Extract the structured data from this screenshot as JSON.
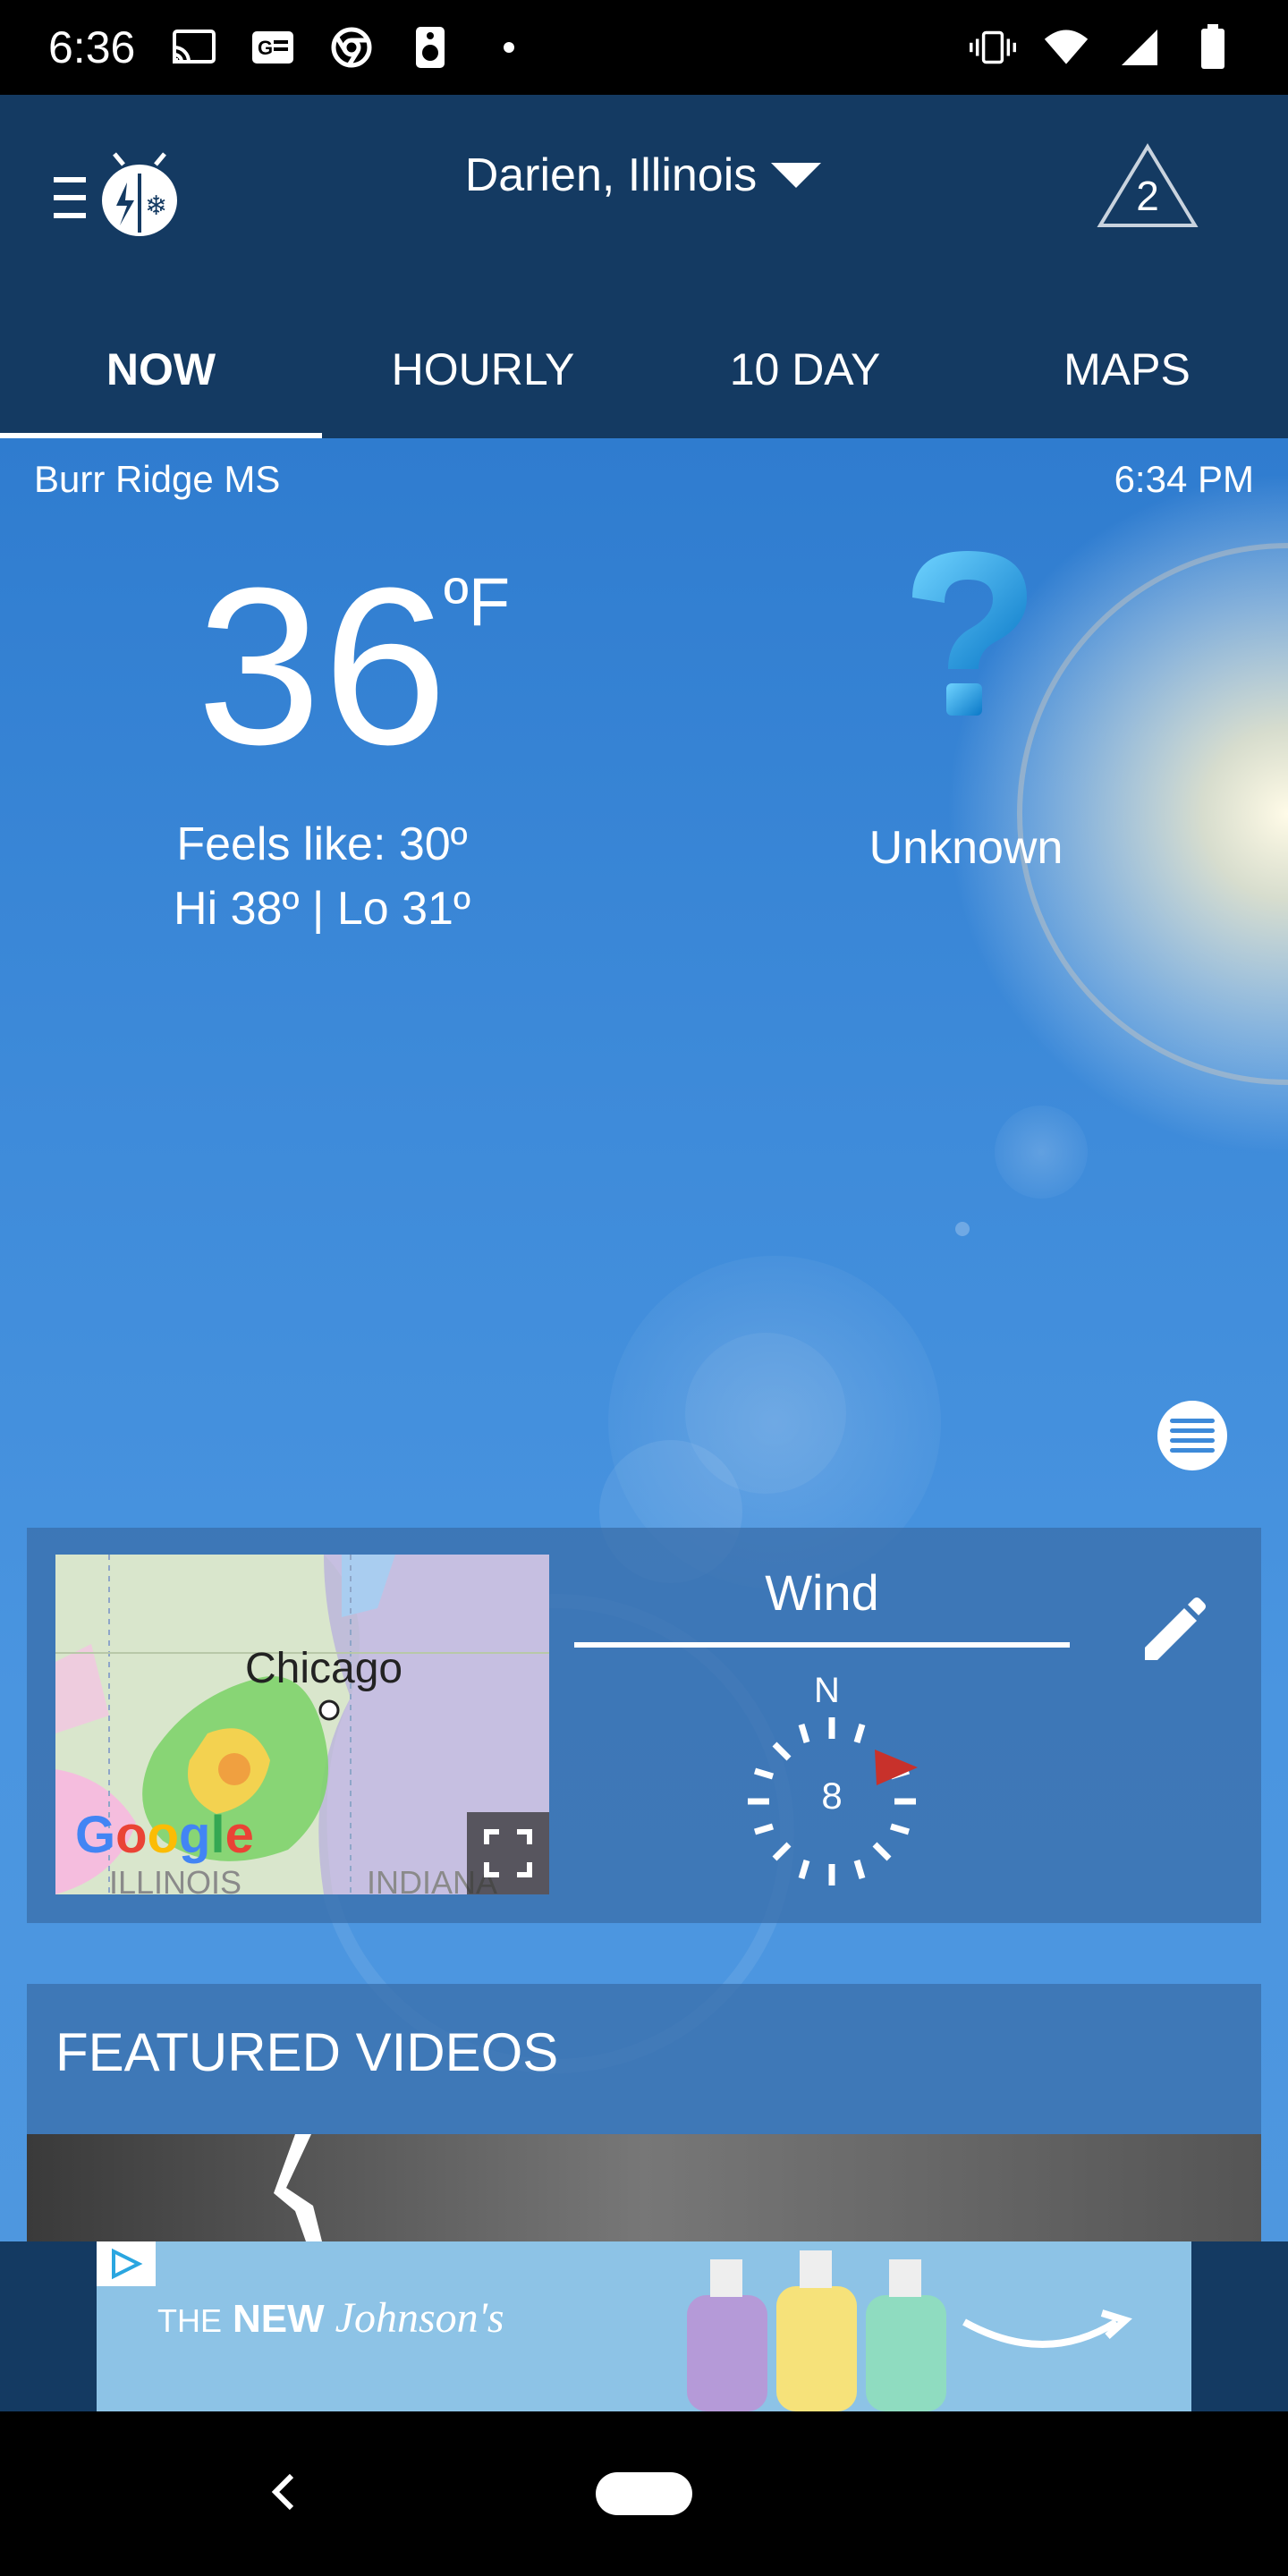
{
  "status_bar": {
    "time": "6:36",
    "left_icons": [
      "cast-icon",
      "news-icon",
      "chrome-icon",
      "speaker-icon",
      "dot-icon"
    ],
    "right_icons": [
      "vibrate-icon",
      "wifi-icon",
      "signal-icon",
      "battery-icon"
    ]
  },
  "header": {
    "location": "Darien, Illinois",
    "alert_count": "2",
    "tabs": [
      {
        "label": "NOW",
        "active": true
      },
      {
        "label": "HOURLY",
        "active": false
      },
      {
        "label": "10 DAY",
        "active": false
      },
      {
        "label": "MAPS",
        "active": false
      }
    ]
  },
  "current": {
    "station": "Burr Ridge MS",
    "observed_time": "6:34 PM",
    "temperature": "36",
    "unit": "ºF",
    "feels_like": "Feels like: 30º",
    "hi_lo": "Hi 38º | Lo 31º",
    "condition": "Unknown",
    "condition_icon": "question-mark-icon"
  },
  "map_card": {
    "city_label": "Chicago",
    "provider": "Google",
    "region_left": "ILLINOIS",
    "region_right": "INDIANA"
  },
  "wind_card": {
    "title": "Wind",
    "direction_label": "N",
    "speed": "8"
  },
  "featured": {
    "title": "FEATURED VIDEOS"
  },
  "ad": {
    "the": "THE",
    "new": "NEW",
    "brand": "Johnson's"
  },
  "colors": {
    "header_bg": "#143a62",
    "sky_blue": "#3d8ad9",
    "card_bg": "#3a6eaa",
    "wind_arrow": "#c8312b"
  }
}
